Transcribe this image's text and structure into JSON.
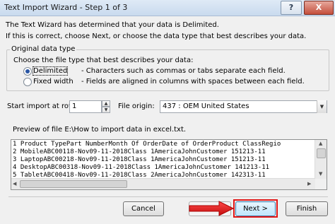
{
  "window": {
    "title": "Text Import Wizard - Step 1 of 3",
    "help_glyph": "?",
    "close_glyph": "X"
  },
  "intro": {
    "line1": "The Text Wizard has determined that your data is Delimited.",
    "line2": "If this is correct, choose Next, or choose the data type that best describes your data."
  },
  "original_data_type": {
    "legend": "Original data type",
    "prompt": "Choose the file type that best describes your data:",
    "options": [
      {
        "label": "Delimited",
        "description": "- Characters such as commas or tabs separate each field.",
        "checked": true
      },
      {
        "label": "Fixed width",
        "description": "- Fields are aligned in columns with spaces between each field.",
        "checked": false
      }
    ]
  },
  "start_import": {
    "label": "Start import at row:",
    "value": "1"
  },
  "file_origin": {
    "label": "File origin:",
    "value": "437 : OEM United States"
  },
  "preview": {
    "label": "Preview of file E:\\How to import data in excel.txt.",
    "lines": [
      "1 Product TypePart NumberMonth Of OrderDate of OrderProduct ClassRegio",
      "2 MobileABC00118-Nov09-11-2018Class 1AmericaJohnCustomer 151213-11",
      "3 LaptopABC00218-Nov09-11-2018Class 1AmericaJohnCustomer 151213-11",
      "4 DesktopABC00318-Nov09-11-2018Class 1AmericaJohnCustomer 141213-11",
      "5 TabletABC00418-Nov09-11-2018Class 2AmericaJohnCustomer 142313-11"
    ]
  },
  "buttons": {
    "cancel": "Cancel",
    "back": "< Back",
    "next": "Next >",
    "finish": "Finish"
  },
  "colors": {
    "annotation_red": "#e01616",
    "titlebar": "#c9daee",
    "close_button": "#c44f3c"
  }
}
